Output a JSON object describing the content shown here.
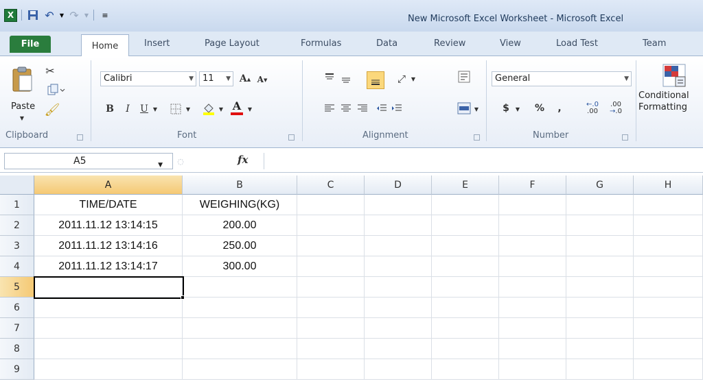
{
  "window": {
    "title": "New Microsoft Excel Worksheet  -  Microsoft Excel",
    "app_icon": "X",
    "qat": [
      {
        "name": "save-icon",
        "glyph": "💾"
      },
      {
        "name": "undo-icon",
        "glyph": "↶"
      },
      {
        "name": "redo-icon",
        "glyph": "↷"
      },
      {
        "name": "customize-qat-icon",
        "glyph": "="
      }
    ]
  },
  "tabs": [
    "File",
    "Home",
    "Insert",
    "Page Layout",
    "Formulas",
    "Data",
    "Review",
    "View",
    "Load Test",
    "Team"
  ],
  "ribbon": {
    "clipboard": {
      "label": "Clipboard",
      "paste": "Paste"
    },
    "font": {
      "label": "Font",
      "name": "Calibri",
      "size": "11",
      "bold": "B",
      "italic": "I",
      "underline": "U",
      "font_color": "A",
      "grow": "A",
      "shrink": "A"
    },
    "alignment": {
      "label": "Alignment"
    },
    "number": {
      "label": "Number",
      "format": "General",
      "currency": "$",
      "percent": "%",
      "comma": ",",
      "inc_dec": ".00",
      "dec_dec": ".0"
    },
    "styles": {
      "conditional_1": "Conditional",
      "conditional_2": "Formatting"
    }
  },
  "formula_bar": {
    "name_box": "A5",
    "fx": "fx",
    "value": ""
  },
  "sheet": {
    "columns": [
      "A",
      "B",
      "C",
      "D",
      "E",
      "F",
      "G",
      "H"
    ],
    "rows": [
      "1",
      "2",
      "3",
      "4",
      "5",
      "6",
      "7",
      "8",
      "9"
    ],
    "active_cell": "A5",
    "cells": {
      "A1": "TIME/DATE",
      "B1": "WEIGHING(KG)",
      "A2": "2011.11.12 13:14:15",
      "B2": "200.00",
      "A3": "2011.11.12 13:14:16",
      "B3": "250.00",
      "A4": "2011.11.12 13:14:17",
      "B4": "300.00"
    }
  }
}
